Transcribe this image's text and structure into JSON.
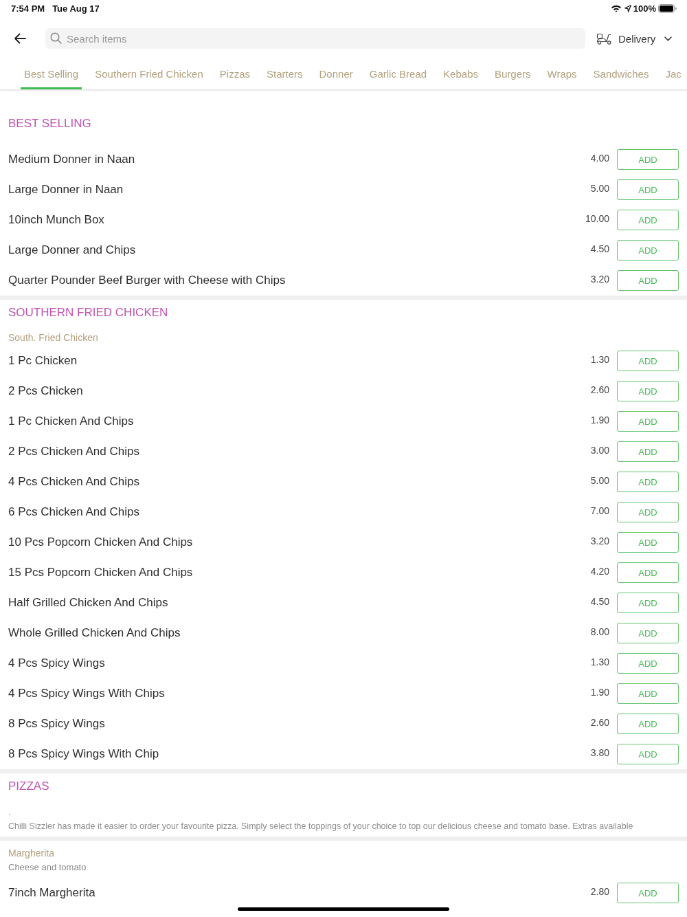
{
  "status_bar": {
    "time": "7:54 PM",
    "date": "Tue Aug 17",
    "battery": "100%"
  },
  "header": {
    "search": {
      "placeholder": "Search items"
    },
    "delivery": {
      "label": "Delivery"
    }
  },
  "tabs": [
    {
      "label": "Best Selling",
      "selected": true
    },
    {
      "label": "Southern Fried Chicken",
      "selected": false
    },
    {
      "label": "Pizzas",
      "selected": false
    },
    {
      "label": "Starters",
      "selected": false
    },
    {
      "label": "Donner",
      "selected": false
    },
    {
      "label": "Garlic Bread",
      "selected": false
    },
    {
      "label": "Kebabs",
      "selected": false
    },
    {
      "label": "Burgers",
      "selected": false
    },
    {
      "label": "Wraps",
      "selected": false
    },
    {
      "label": "Sandwiches",
      "selected": false
    },
    {
      "label": "Jac",
      "selected": false
    }
  ],
  "sections": [
    {
      "title": "BEST SELLING",
      "groups": [
        {
          "items": [
            {
              "name": "Medium Donner in Naan",
              "price": "4.00",
              "button": "ADD"
            },
            {
              "name": "Large Donner in Naan",
              "price": "5.00",
              "button": "ADD"
            },
            {
              "name": "10inch Munch Box",
              "price": "10.00",
              "button": "ADD"
            },
            {
              "name": "Large Donner and Chips",
              "price": "4.50",
              "button": "ADD"
            },
            {
              "name": "Quarter Pounder Beef Burger with Cheese with Chips",
              "price": "3.20",
              "button": "ADD"
            }
          ]
        }
      ]
    },
    {
      "title": "SOUTHERN FRIED CHICKEN",
      "groups": [
        {
          "heading": "South. Fried Chicken",
          "items": [
            {
              "name": "1 Pc Chicken",
              "price": "1.30",
              "button": "ADD"
            },
            {
              "name": "2 Pcs Chicken",
              "price": "2.60",
              "button": "ADD"
            },
            {
              "name": "1 Pc Chicken And Chips",
              "price": "1.90",
              "button": "ADD"
            },
            {
              "name": "2 Pcs Chicken And Chips",
              "price": "3.00",
              "button": "ADD"
            },
            {
              "name": "4 Pcs Chicken And Chips",
              "price": "5.00",
              "button": "ADD"
            },
            {
              "name": "6 Pcs Chicken And Chips",
              "price": "7.00",
              "button": "ADD"
            },
            {
              "name": "10 Pcs Popcorn Chicken And Chips",
              "price": "3.20",
              "button": "ADD"
            },
            {
              "name": "15 Pcs Popcorn Chicken And Chips",
              "price": "4.20",
              "button": "ADD"
            },
            {
              "name": "Half Grilled Chicken And Chips",
              "price": "4.50",
              "button": "ADD"
            },
            {
              "name": "Whole Grilled Chicken And Chips",
              "price": "8.00",
              "button": "ADD"
            },
            {
              "name": "4 Pcs Spicy Wings",
              "price": "1.30",
              "button": "ADD"
            },
            {
              "name": "4 Pcs Spicy Wings With Chips",
              "price": "1.90",
              "button": "ADD"
            },
            {
              "name": "8 Pcs Spicy Wings",
              "price": "2.60",
              "button": "ADD"
            },
            {
              "name": "8 Pcs Spicy Wings With Chip",
              "price": "3.80",
              "button": "ADD"
            }
          ]
        }
      ]
    },
    {
      "title": "PIZZAS",
      "note": ".",
      "description": "Chilli Sizzler has made it easier to order your favourite pizza. Simply select the toppings of your choice to top our delicious cheese and tomato base. Extras available",
      "groups": [
        {
          "heading": "Margherita",
          "description": "Cheese and tomato",
          "items": [
            {
              "name": "7inch Margherita",
              "price": "2.80",
              "button": "ADD"
            }
          ]
        }
      ]
    }
  ]
}
